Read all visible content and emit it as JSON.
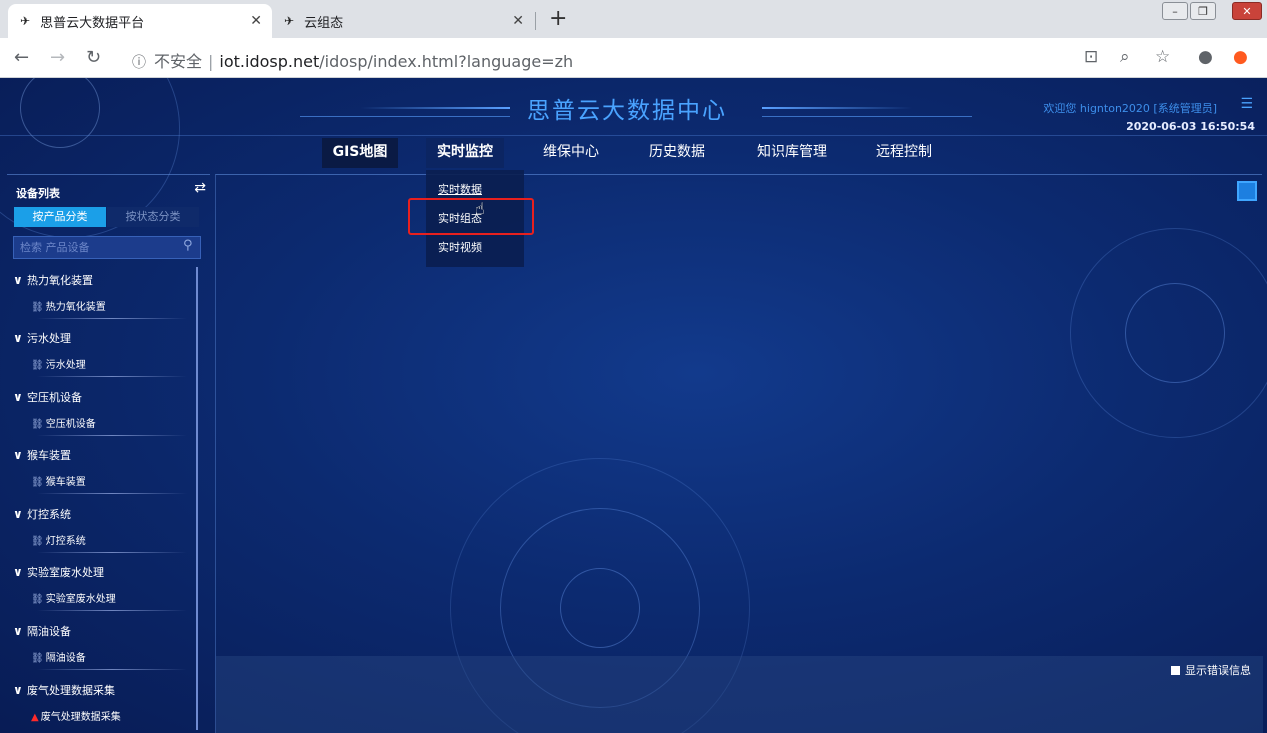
{
  "browser": {
    "tabs": [
      {
        "title": "思普云大数据平台",
        "active": true
      },
      {
        "title": "云组态",
        "active": false
      }
    ],
    "address": {
      "security_label": "不安全",
      "host": "iot.idosp.net",
      "path": "/idosp/index.html?language=zh"
    }
  },
  "header": {
    "title": "思普云大数据中心",
    "welcome": "欢迎您 hignton2020 [系统管理员]",
    "datetime": "2020-06-03 16:50:54"
  },
  "nav": {
    "items": [
      "GIS地图",
      "实时监控",
      "维保中心",
      "历史数据",
      "知识库管理",
      "远程控制"
    ],
    "active": "实时监控",
    "dropdown": [
      "实时数据",
      "实时组态",
      "实时视频"
    ]
  },
  "sidebar": {
    "title": "设备列表",
    "tabs": [
      "按产品分类",
      "按状态分类"
    ],
    "search_placeholder": "检索 产品设备",
    "groups": [
      {
        "name": "热力氧化装置",
        "child": "热力氧化装置"
      },
      {
        "name": "污水处理",
        "child": "污水处理"
      },
      {
        "name": "空压机设备",
        "child": "空压机设备"
      },
      {
        "name": "猴车装置",
        "child": "猴车装置"
      },
      {
        "name": "灯控系统",
        "child": "灯控系统"
      },
      {
        "name": "实验室废水处理",
        "child": "实验室废水处理"
      },
      {
        "name": "隔油设备",
        "child": "隔油设备"
      },
      {
        "name": "废气处理数据采集",
        "child": "废气处理数据采集",
        "status": "warning"
      }
    ]
  },
  "content": {
    "show_error_label": "显示错误信息"
  },
  "colors": {
    "accent": "#1b9fe8",
    "title": "#4aa3ff",
    "highlight": "#e8201e",
    "warning": "#ff2a2a"
  }
}
